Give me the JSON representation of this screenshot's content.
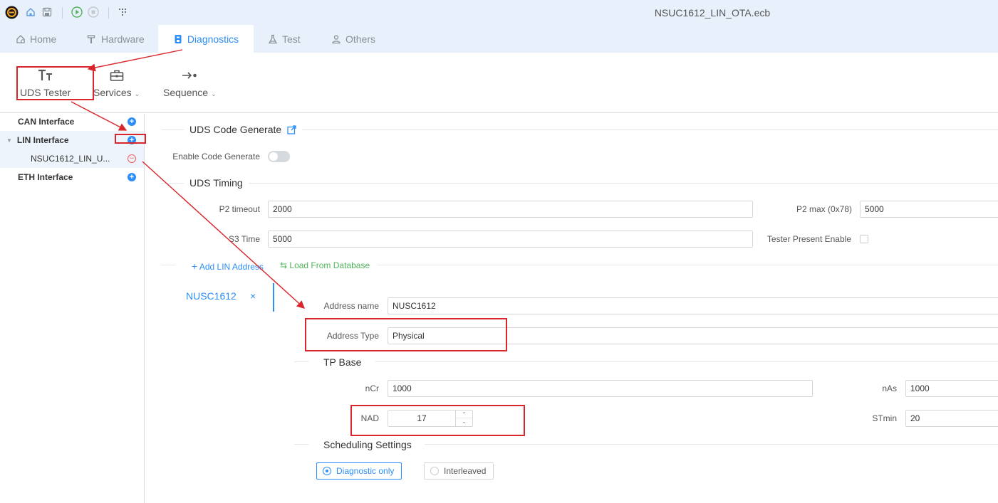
{
  "window": {
    "title": "NSUC1612_LIN_OTA.ecb"
  },
  "menu_tabs": [
    {
      "label": "Home",
      "icon": "home-gear-icon"
    },
    {
      "label": "Hardware",
      "icon": "hammer-icon"
    },
    {
      "label": "Diagnostics",
      "icon": "diagnostics-icon",
      "active": true
    },
    {
      "label": "Test",
      "icon": "flask-icon"
    },
    {
      "label": "Others",
      "icon": "user-icon"
    }
  ],
  "ribbon": {
    "uds_tester": "UDS Tester",
    "services": "Services",
    "sequence": "Sequence"
  },
  "sidebar": {
    "can": "CAN Interface",
    "lin": "LIN Interface",
    "lin_child": "NSUC1612_LIN_U...",
    "eth": "ETH Interface"
  },
  "main": {
    "code_generate": {
      "title": "UDS Code Generate",
      "enable_label": "Enable Code Generate"
    },
    "timing": {
      "title": "UDS Timing",
      "p2_timeout_label": "P2 timeout",
      "p2_timeout": "2000",
      "p2_max_label": "P2 max (0x78)",
      "p2_max": "5000",
      "s3_time_label": "S3 Time",
      "s3_time": "5000",
      "tester_present_label": "Tester Present Enable"
    },
    "actions": {
      "add_lin_address": "Add LIN Address",
      "load_from_database": "Load From Database"
    },
    "address_tab": "NUSC1612",
    "address": {
      "name_label": "Address name",
      "name": "NUSC1612",
      "type_label": "Address Type",
      "type": "Physical"
    },
    "tp_base": {
      "title": "TP Base",
      "ncr_label": "nCr",
      "ncr": "1000",
      "nas_label": "nAs",
      "nas": "1000",
      "nad_label": "NAD",
      "nad": "17",
      "stmin_label": "STmin",
      "stmin": "20"
    },
    "scheduling": {
      "title": "Scheduling Settings",
      "option_diagnostic": "Diagnostic only",
      "option_interleaved": "Interleaved",
      "selected": "Diagnostic only"
    }
  },
  "colors": {
    "accent": "#2c8ef8",
    "annotation": "#d9262c",
    "header_bg": "#e8f1fb",
    "green_link": "#4fb35a"
  }
}
